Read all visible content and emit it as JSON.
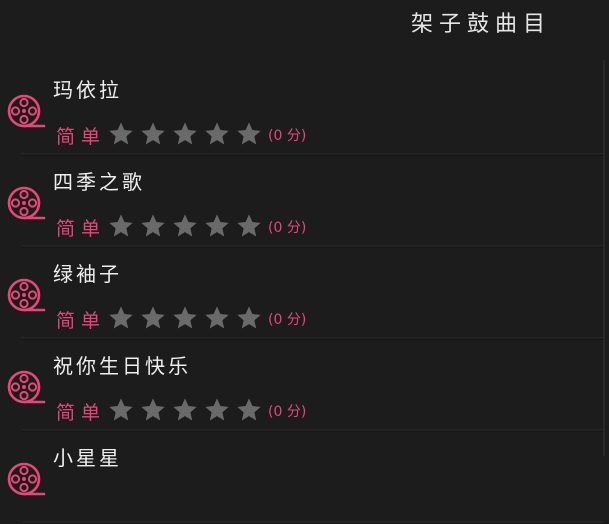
{
  "header": {
    "title": "架子鼓曲目"
  },
  "songs": [
    {
      "name": "玛依拉",
      "difficulty": "简单",
      "rating": 0,
      "score": "(0 分)"
    },
    {
      "name": "四季之歌",
      "difficulty": "简单",
      "rating": 0,
      "score": "(0 分)"
    },
    {
      "name": "绿袖子",
      "difficulty": "简单",
      "rating": 0,
      "score": "(0 分)"
    },
    {
      "name": "祝你生日快乐",
      "difficulty": "简单",
      "rating": 0,
      "score": "(0 分)"
    },
    {
      "name": "小星星",
      "difficulty": "",
      "rating": 0,
      "score": ""
    }
  ],
  "icons": {
    "song": "film-reel-icon",
    "rating": "star-icon"
  },
  "colors": {
    "background": "#1d1c1d",
    "accent": "#e54778",
    "star_empty": "#6a6a6a",
    "text": "#efefef"
  }
}
